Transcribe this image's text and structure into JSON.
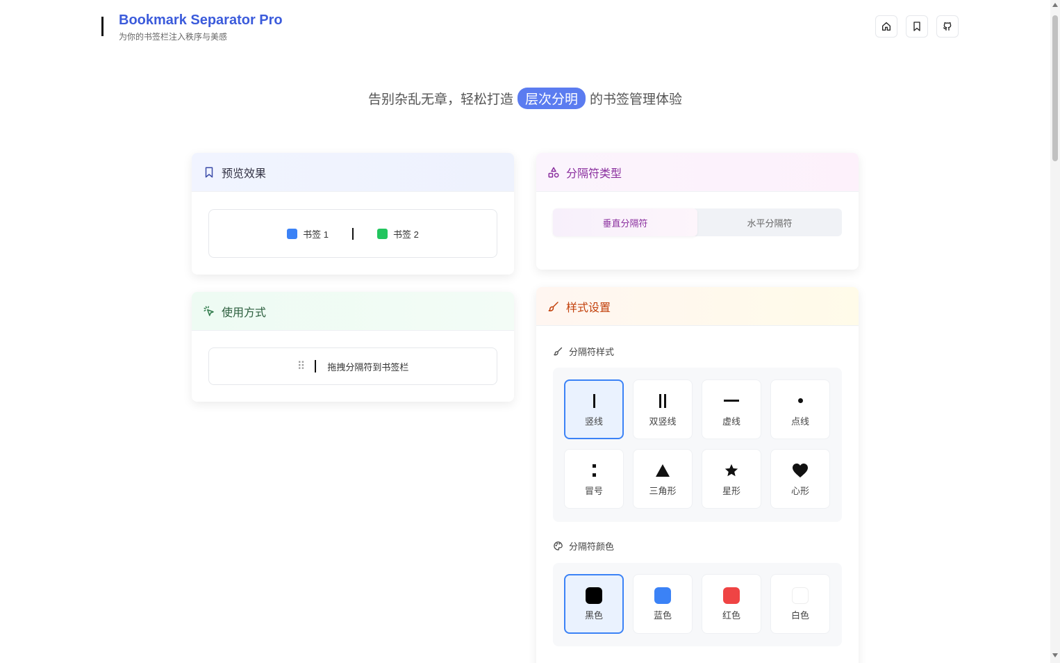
{
  "app": {
    "title": "Bookmark Separator Pro",
    "subtitle": "为你的书签栏注入秩序与美感"
  },
  "header_buttons": [
    {
      "icon": "home-icon"
    },
    {
      "icon": "bookmark-icon"
    },
    {
      "icon": "github-icon"
    }
  ],
  "tagline": {
    "before": "告别杂乱无章，轻松打造",
    "highlight": "层次分明",
    "after": "的书签管理体验"
  },
  "preview": {
    "title": "预览效果",
    "bookmark1": {
      "label": "书签 1",
      "color": "#3b82f6"
    },
    "bookmark2": {
      "label": "书签 2",
      "color": "#22c55e"
    }
  },
  "usage": {
    "title": "使用方式",
    "instruction": "拖拽分隔符到书签栏"
  },
  "separator_type": {
    "title": "分隔符类型",
    "tabs": [
      "垂直分隔符",
      "水平分隔符"
    ],
    "active_tab": "垂直分隔符"
  },
  "style_settings": {
    "title": "样式设置",
    "style_label": "分隔符样式",
    "styles": [
      {
        "name": "竖线",
        "glyph": "|",
        "selected": true
      },
      {
        "name": "双竖线",
        "glyph": "||",
        "selected": false
      },
      {
        "name": "虚线",
        "glyph": "—",
        "selected": false
      },
      {
        "name": "点线",
        "glyph": "•",
        "selected": false
      },
      {
        "name": "冒号",
        "glyph": ":",
        "selected": false
      },
      {
        "name": "三角形",
        "glyph": "▲",
        "selected": false
      },
      {
        "name": "星形",
        "glyph": "★",
        "selected": false
      },
      {
        "name": "心形",
        "glyph": "♥",
        "selected": false
      }
    ],
    "color_label": "分隔符颜色",
    "colors": [
      {
        "name": "黑色",
        "hex": "#000000",
        "selected": true
      },
      {
        "name": "蓝色",
        "hex": "#3b82f6",
        "selected": false
      },
      {
        "name": "红色",
        "hex": "#ef4444",
        "selected": false
      },
      {
        "name": "白色",
        "hex": "#ffffff",
        "selected": false
      }
    ]
  }
}
